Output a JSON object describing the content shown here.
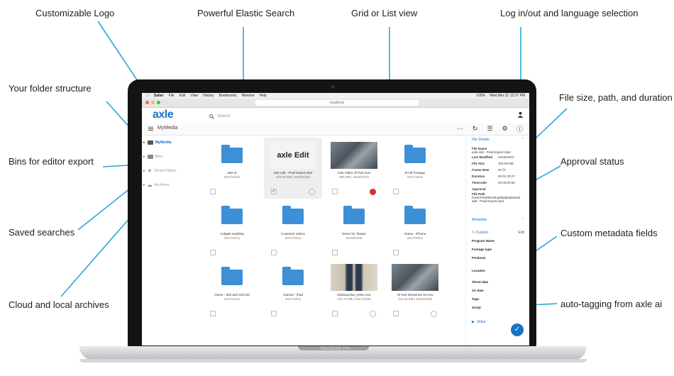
{
  "callouts": {
    "logo": "Customizable Logo",
    "search": "Powerful Elastic Search",
    "view": "Grid or List view",
    "login": "Log in/out and language selection",
    "folders": "Your folder structure",
    "bins": "Bins for editor export",
    "saved": "Saved searches",
    "archives": "Cloud and local archives",
    "filesize": "File size, path, and duration",
    "approval": "Approval status",
    "metadata": "Custom metadata fields",
    "autotag": "auto-tagging from axle ai"
  },
  "laptop": {
    "brand": "MacBook Pro"
  },
  "macbar": {
    "items": [
      "Safari",
      "File",
      "Edit",
      "View",
      "History",
      "Bookmarks",
      "Window",
      "Help"
    ],
    "battery": "100%",
    "clock": "Wed Mar 31 12:37 PM"
  },
  "browser": {
    "url": "localhost"
  },
  "app": {
    "logo": "axle",
    "search_placeholder": "Search",
    "breadcrumb": "MyMedia"
  },
  "sidebar": {
    "items": [
      {
        "label": "MyMedia"
      },
      {
        "label": "Bins"
      },
      {
        "label": "Smart Filters"
      },
      {
        "label": "Archives"
      }
    ]
  },
  "tiles": [
    {
      "name": "axle ai",
      "meta": "2017/10/31",
      "type": "folder"
    },
    {
      "name": "axle edit - Final Export.mp4",
      "meta": "333.08 MB | 2015/04/02",
      "type": "edit",
      "thumb_text": "axle Edit"
    },
    {
      "name": "Axle Video cfr-huh.mov",
      "meta": "995 MB | 2015/01/03",
      "type": "video"
    },
    {
      "name": "B-roll Footage",
      "meta": "2017/10/31",
      "type": "folder"
    },
    {
      "name": "Colgate wedding",
      "meta": "2017/10/31",
      "type": "folder"
    },
    {
      "name": "Customer videos",
      "meta": "2017/10/31",
      "type": "folder"
    },
    {
      "name": "Demo for Taiwan",
      "meta": "2018/02/06",
      "type": "folder"
    },
    {
      "name": "Game - iPhone",
      "meta": "2017/10/31",
      "type": "folder"
    },
    {
      "name": "Game - 920 and X0CAM",
      "meta": "2017/11/12",
      "type": "folder"
    },
    {
      "name": "Game2 - iPad",
      "meta": "2017/10/31",
      "type": "folder"
    },
    {
      "name": "sharkauction_test1.mov",
      "meta": "133.72 MB | 2017/10/25",
      "type": "video2"
    },
    {
      "name": "cfr-huh shortened 10.mov",
      "meta": "131.64 MB | 2015/10/05",
      "type": "video"
    }
  ],
  "panel": {
    "file_details": "File Details",
    "rows": [
      {
        "k": "File Name",
        "v": ""
      },
      {
        "k": "Last Modified",
        "v": "2015/04/02"
      },
      {
        "k": "File Size",
        "v": "333.08 MB"
      },
      {
        "k": "Frame Rate",
        "v": "30 f/s"
      },
      {
        "k": "Duration",
        "v": "00:01:29:27"
      },
      {
        "k": "Timecode",
        "v": "00:00:00:00"
      },
      {
        "k": "Approval",
        "v": ""
      }
    ],
    "file_name_value": "axle edit - Final Export.mp4",
    "file_path_label": "File Path",
    "file_path_value": "/Users/Ted/Desktop/MyMedia/axle edit - Final Export.mp4",
    "metadata": "Metadata",
    "custom": "Custom",
    "edit": "Edit",
    "fields": [
      "Program Name",
      "Footage type",
      "Producer",
      "Location",
      "Shoot date",
      "Air date",
      "Tags",
      "Script"
    ],
    "video": "Video"
  },
  "colors": {
    "accent": "#1a73c5",
    "callout_line": "#2aa7d6"
  }
}
